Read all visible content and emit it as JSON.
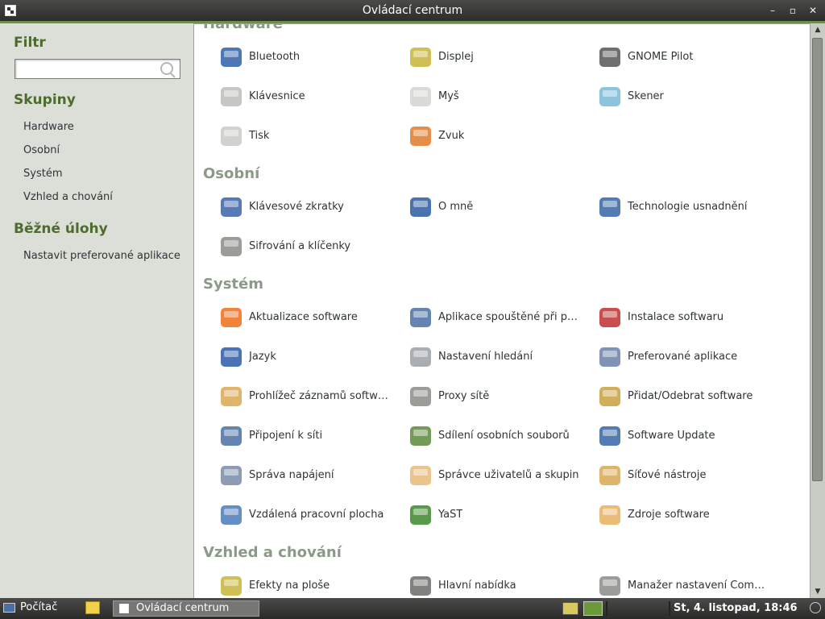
{
  "window": {
    "title": "Ovládací centrum",
    "controls": [
      "–",
      "▫",
      "✕"
    ]
  },
  "sidebar": {
    "filter_heading": "Filtr",
    "search_placeholder": "",
    "groups_heading": "Skupiny",
    "groups": [
      "Hardware",
      "Osobní",
      "Systém",
      "Vzhled a chování"
    ],
    "tasks_heading": "Běžné úlohy",
    "tasks": [
      "Nastavit preferované aplikace"
    ]
  },
  "sections": [
    {
      "title": "Hardware",
      "items": [
        {
          "label": "Bluetooth",
          "icon": "bluetooth-icon",
          "color": "#2f5fa8"
        },
        {
          "label": "Displej",
          "icon": "display-icon",
          "color": "#c8b43a"
        },
        {
          "label": "GNOME Pilot",
          "icon": "pda-icon",
          "color": "#555753"
        },
        {
          "label": "Klávesnice",
          "icon": "keyboard-icon",
          "color": "#bcbdb8"
        },
        {
          "label": "Myš",
          "icon": "mouse-icon",
          "color": "#d3d5d0"
        },
        {
          "label": "Skener",
          "icon": "scanner-icon",
          "color": "#7ab8d8"
        },
        {
          "label": "Tisk",
          "icon": "printer-icon",
          "color": "#c9cac5"
        },
        {
          "label": "Zvuk",
          "icon": "sound-icon",
          "color": "#e07a2a"
        }
      ]
    },
    {
      "title": "Osobní",
      "items": [
        {
          "label": "Klávesové zkratky",
          "icon": "shortcuts-icon",
          "color": "#3a62a8"
        },
        {
          "label": "O mně",
          "icon": "about-me-icon",
          "color": "#2c5aa0"
        },
        {
          "label": "Technologie usnadnění",
          "icon": "accessibility-icon",
          "color": "#3465a4"
        },
        {
          "label": "Šifrování a klíčenky",
          "icon": "encryption-icon",
          "color": "#8a8c86"
        }
      ]
    },
    {
      "title": "Systém",
      "items": [
        {
          "label": "Aktualizace software",
          "icon": "software-update-icon",
          "color": "#ee6e1a"
        },
        {
          "label": "Aplikace spouštěné při přihlášení",
          "icon": "startup-apps-icon",
          "color": "#4a6fa5"
        },
        {
          "label": "Instalace softwaru",
          "icon": "install-software-icon",
          "color": "#c03030"
        },
        {
          "label": "Jazyk",
          "icon": "language-icon",
          "color": "#2a5aa8"
        },
        {
          "label": "Nastavení hledání",
          "icon": "search-settings-icon",
          "color": "#9aa0a6"
        },
        {
          "label": "Preferované aplikace",
          "icon": "preferred-apps-icon",
          "color": "#6a7fa8"
        },
        {
          "label": "Prohlížeč záznamů softwaru",
          "icon": "log-viewer-icon",
          "color": "#d8a850"
        },
        {
          "label": "Proxy sítě",
          "icon": "network-proxy-icon",
          "color": "#8a8c86"
        },
        {
          "label": "Přidat/Odebrat software",
          "icon": "add-remove-icon",
          "color": "#c8a040"
        },
        {
          "label": "Připojení k síti",
          "icon": "network-connections-icon",
          "color": "#4a6fa5"
        },
        {
          "label": "Sdílení osobních souborů",
          "icon": "file-sharing-icon",
          "color": "#5a8a3a"
        },
        {
          "label": "Software Update",
          "icon": "globe-update-icon",
          "color": "#3465a4"
        },
        {
          "label": "Správa napájení",
          "icon": "power-management-icon",
          "color": "#7a8aa8"
        },
        {
          "label": "Správce uživatelů a skupin",
          "icon": "users-groups-icon",
          "color": "#e8b878"
        },
        {
          "label": "Síťové nástroje",
          "icon": "network-tools-icon",
          "color": "#d8a850"
        },
        {
          "label": "Vzdálená pracovní plocha",
          "icon": "remote-desktop-icon",
          "color": "#4a7ab8"
        },
        {
          "label": "YaST",
          "icon": "yast-icon",
          "color": "#3a8a2a"
        },
        {
          "label": "Zdroje software",
          "icon": "software-sources-icon",
          "color": "#e8b060"
        }
      ]
    },
    {
      "title": "Vzhled a chování",
      "items": [
        {
          "label": "Efekty na ploše",
          "icon": "desktop-effects-icon",
          "color": "#c8b43a"
        },
        {
          "label": "Hlavní nabídka",
          "icon": "main-menu-icon",
          "color": "#6a6c68"
        },
        {
          "label": "Manažer nastavení CompizConfig",
          "icon": "compiz-icon",
          "color": "#8a8c86"
        }
      ]
    }
  ],
  "taskbar": {
    "start_label": "Počítač",
    "task_label": "Ovládací centrum",
    "clock": "St,  4. listopad, 18:46"
  }
}
